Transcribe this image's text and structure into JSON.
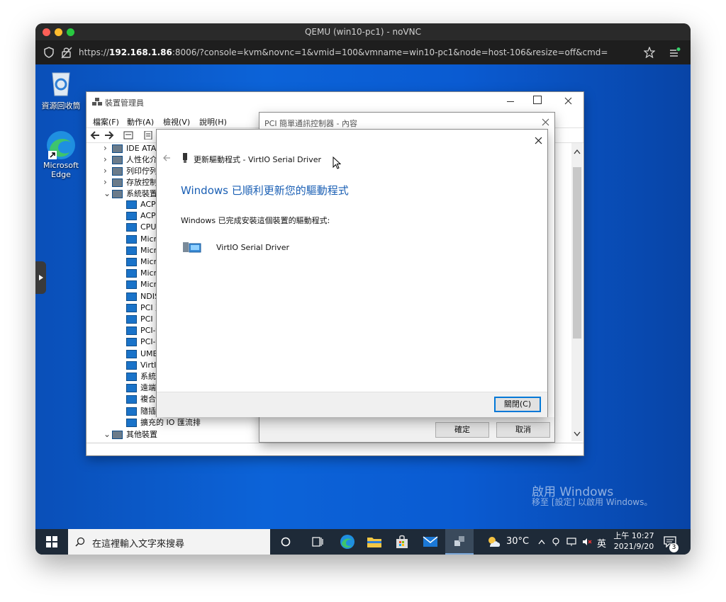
{
  "browser": {
    "title": "QEMU (win10-pc1) - noVNC",
    "url_prefix": "https://",
    "url_host": "192.168.1.86",
    "url_rest": ":8006/?console=kvm&novnc=1&vmid=100&vmname=win10-pc1&node=host-106&resize=off&cmd="
  },
  "desktop": {
    "recycle_label": "資源回收筒",
    "edge_label_1": "Microsoft",
    "edge_label_2": "Edge",
    "watermark_1": "啟用 Windows",
    "watermark_2": "移至 [設定] 以啟用 Windows。"
  },
  "devmgr": {
    "title": "裝置管理員",
    "menu": [
      "檔案(F)",
      "動作(A)",
      "檢視(V)",
      "說明(H)"
    ],
    "categories": [
      "IDE ATA",
      "人性化介",
      "列印佇列",
      "存放控制",
      "系統裝置"
    ],
    "devices": [
      "ACPI",
      "ACPI",
      "CPU",
      "Micr",
      "Micr",
      "Micr",
      "Micr",
      "Micr",
      "NDIS",
      "PCI 至",
      "PCI 匯",
      "PCI-t",
      "PCI-t",
      "UMB",
      "VirtIO",
      "系統",
      "遠端",
      "複合",
      "隨插",
      "擴充的 IO 匯流排"
    ],
    "last_category": "其他裝置"
  },
  "props": {
    "title": "PCI 簡單通訊控制器 - 內容",
    "ok_label": "確定",
    "cancel_label": "取消"
  },
  "wizard": {
    "header": "更新驅動程式 - VirtIO Serial Driver",
    "heading": "Windows 已順利更新您的驅動程式",
    "body": "Windows 已完成安裝這個裝置的驅動程式:",
    "driver_name": "VirtIO Serial Driver",
    "close_label": "關閉(C)",
    "heading_color": "#1a5fb4"
  },
  "taskbar": {
    "search_placeholder": "在這裡輸入文字來搜尋",
    "temperature": "30°C",
    "ime": "英",
    "time": "上午 10:27",
    "date": "2021/9/20",
    "notifications": "3"
  }
}
